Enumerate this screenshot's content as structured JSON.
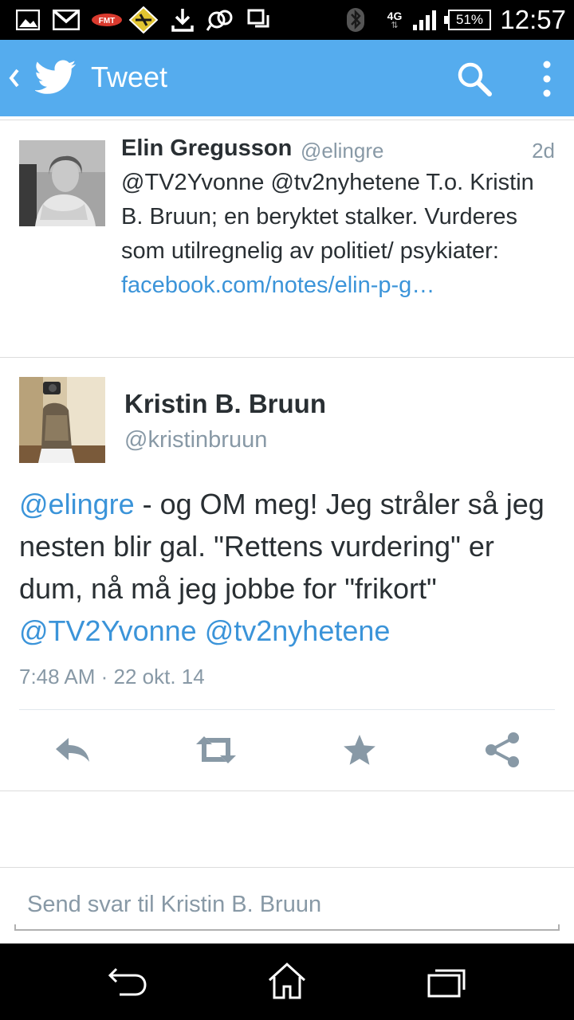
{
  "status_bar": {
    "battery_percent": "51%",
    "network": "4G",
    "time": "12:57",
    "icons": [
      "gallery-icon",
      "gmail-icon",
      "fmt-app-icon",
      "news-app-icon",
      "download-icon",
      "sync-icon",
      "screen-icon",
      "bluetooth-icon",
      "signal-icon",
      "battery-icon"
    ]
  },
  "app_bar": {
    "title": "Tweet",
    "color": "#55acee"
  },
  "tweets": [
    {
      "name": "Elin Gregusson",
      "handle": "@elingre",
      "time": "2d",
      "text_plain": "@TV2Yvonne @tv2nyhetene T.o. Kristin B. Bruun; en beryktet stalker. Vurderes som utilregnelig av politiet/ psykiater: ",
      "link": "facebook.com/notes/elin-p-g…"
    },
    {
      "name": "Kristin B. Bruun",
      "handle": "@kristinbruun",
      "mention_1": "@elingre",
      "text_plain": " - og OM meg! Jeg stråler så jeg nesten blir gal. \"Rettens vurdering\" er dum, nå må jeg jobbe for \"frikort\" ",
      "mention_2": "@TV2Yvonne",
      "mention_3": "@tv2nyhetene",
      "timestamp": "7:48 AM · 22 okt. 14"
    }
  ],
  "actions": [
    "reply-icon",
    "retweet-icon",
    "favorite-icon",
    "share-icon"
  ],
  "reply": {
    "placeholder": "Send svar til Kristin B. Bruun"
  },
  "nav": [
    "back-icon",
    "home-icon",
    "recents-icon"
  ],
  "colors": {
    "link": "#3b94d9",
    "text": "#292f33",
    "muted": "#8899a6",
    "action_icon": "#8899a6"
  }
}
